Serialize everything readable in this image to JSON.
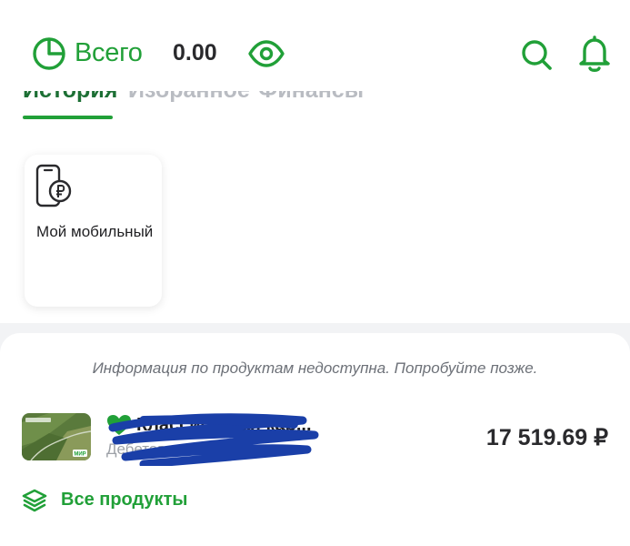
{
  "header": {
    "total_label": "Всего",
    "total_value": "0.00",
    "icons": [
      "pie-chart-icon",
      "eye-icon",
      "search-icon",
      "bell-icon"
    ]
  },
  "tabs": [
    {
      "label": "История",
      "active": true
    },
    {
      "label": "Избранное",
      "active": false
    },
    {
      "label": "Финансы",
      "active": false
    }
  ],
  "favorites": [
    {
      "label": "Мой мобильный",
      "icon": "phone-ruble-icon"
    }
  ],
  "products": {
    "notice": "Информация по продуктам недоступна. Попробуйте позже.",
    "card": {
      "name": "Классическая кар...",
      "type": "Дебетовая",
      "amount": "17 519.69 ₽",
      "payment_system": "МИР"
    },
    "all_label": "Все продукты"
  },
  "colors": {
    "accent": "#21a038",
    "accent_dark": "#1c6f34",
    "text": "#1f1f22",
    "muted": "#6d7178",
    "background": "#f2f3f5",
    "redaction": "#1a3fa8"
  }
}
